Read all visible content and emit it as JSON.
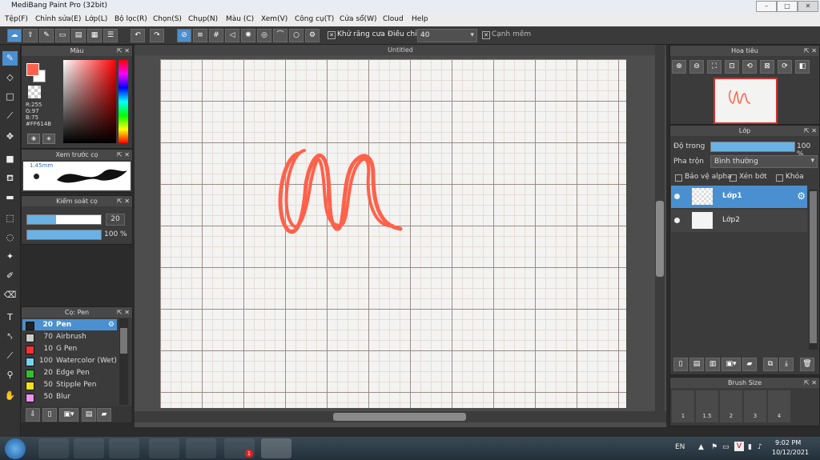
{
  "window": {
    "title": "MediBang Paint Pro (32bit)"
  },
  "menu": [
    "Tệp(F)",
    "Chỉnh sửa(E)",
    "Lớp(L)",
    "Bộ lọc(R)",
    "Chọn(S)",
    "Chụp(N)",
    "Màu (C)",
    "Xem(V)",
    "Công cụ(T)",
    "Cửa sổ(W)",
    "Cloud",
    "Help"
  ],
  "toolbar": {
    "antialias_label": "Khử răng cưa",
    "adjust_label": "Điều chỉnh",
    "adjust_value": "40",
    "smooth_label": "Cạnh mềm"
  },
  "color_panel": {
    "title": "Màu",
    "r": "R:255",
    "g": "G:97",
    "b": "B:75",
    "hex": "#FF614B",
    "accent": "#ff614b"
  },
  "brush_preview": {
    "title": "Xem trước cọ",
    "size": "1.45mm"
  },
  "brush_control": {
    "title": "Kiểm soát cọ",
    "size": "20",
    "opacity": "100 %"
  },
  "brush_list": {
    "title": "Cọ: Pen",
    "items": [
      {
        "size": "20",
        "name": "Pen",
        "color": "#222222"
      },
      {
        "size": "70",
        "name": "Airbrush",
        "color": "#cccccc"
      },
      {
        "size": "10",
        "name": "G Pen",
        "color": "#ff3030"
      },
      {
        "size": "100",
        "name": "Watercolor (Wet)",
        "color": "#7ad0f0"
      },
      {
        "size": "20",
        "name": "Edge Pen",
        "color": "#30c030"
      },
      {
        "size": "50",
        "name": "Stipple Pen",
        "color": "#f0e020"
      },
      {
        "size": "50",
        "name": "Blur",
        "color": "#f090f0"
      }
    ]
  },
  "canvas": {
    "title": "Untitled"
  },
  "navigator": {
    "title": "Hoa tiêu"
  },
  "layers": {
    "title": "Lớp",
    "opacity_label": "Độ trong",
    "opacity_value": "100 %",
    "blend_label": "Pha trộn",
    "blend_value": "Bình thường",
    "protect_alpha": "Bảo vệ alpha",
    "clip": "Xén bớt",
    "lock": "Khóa",
    "items": [
      {
        "name": "Lớp1"
      },
      {
        "name": "Lớp2"
      }
    ]
  },
  "brush_size": {
    "title": "Brush Size",
    "values": [
      "1",
      "1.5",
      "2",
      "3",
      "4"
    ]
  },
  "taskbar": {
    "lang": "EN",
    "time": "9:02 PM",
    "date": "10/12/2021",
    "zalo_badge": "1"
  }
}
